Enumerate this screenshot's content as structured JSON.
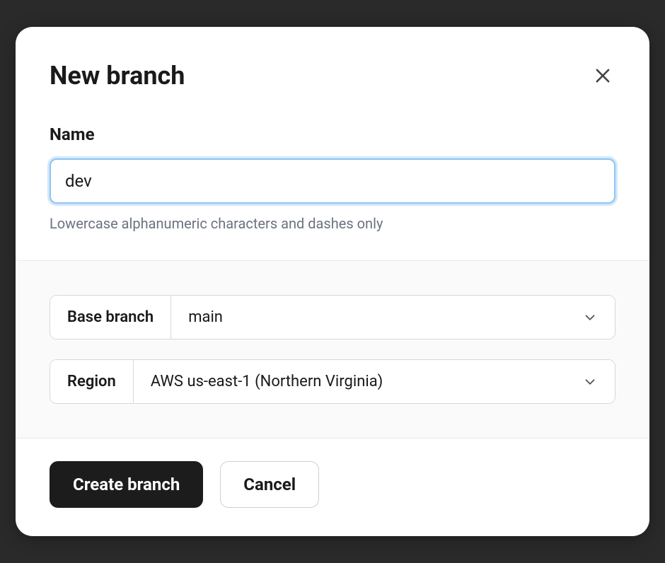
{
  "modal": {
    "title": "New branch"
  },
  "name_field": {
    "label": "Name",
    "value": "dev",
    "help": "Lowercase alphanumeric characters and dashes only"
  },
  "base_branch": {
    "label": "Base branch",
    "value": "main"
  },
  "region": {
    "label": "Region",
    "value": "AWS us-east-1 (Northern Virginia)"
  },
  "footer": {
    "create_label": "Create branch",
    "cancel_label": "Cancel"
  }
}
